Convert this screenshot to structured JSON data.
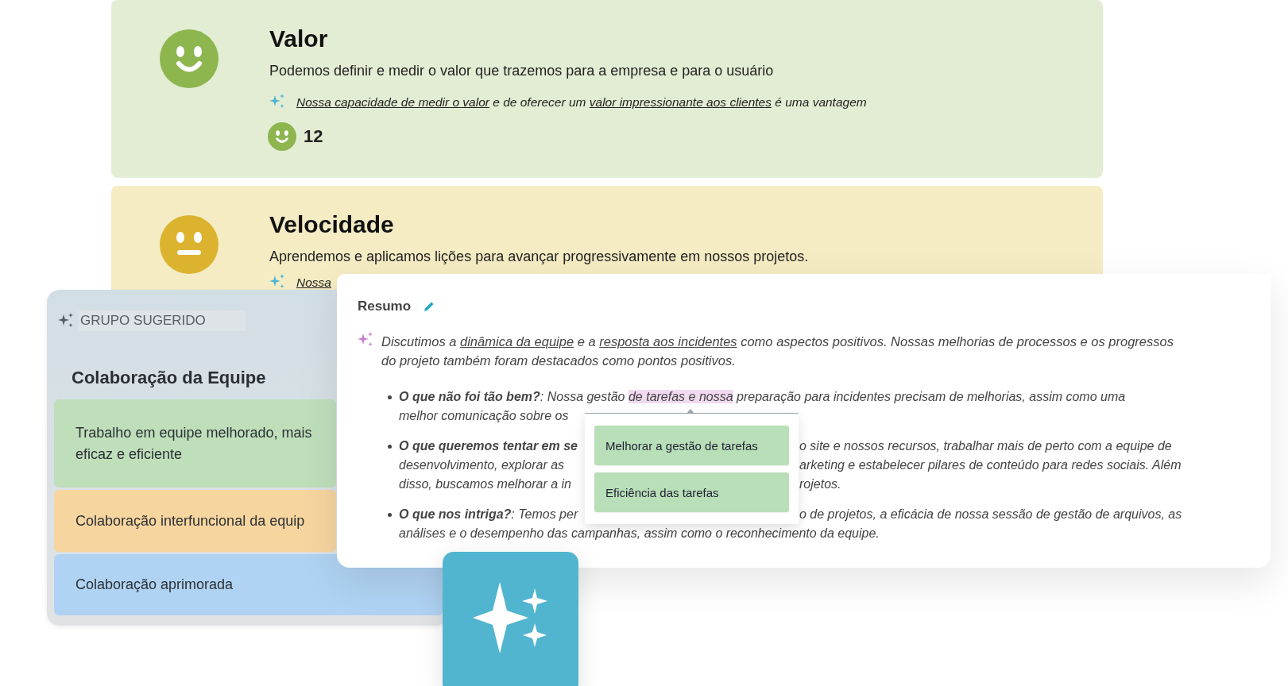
{
  "cards": [
    {
      "title": "Valor",
      "kind": "happy",
      "color": "#e3edd3",
      "description": "Podemos definir e medir o valor que trazemos para a empresa e para o usuário",
      "insight": [
        {
          "text": "Nossa capacidade de medir o valor",
          "link": true
        },
        {
          "text": " e de oferecer um ",
          "link": false
        },
        {
          "text": "valor impressionante aos clientes",
          "link": true
        },
        {
          "text": " é uma vantagem",
          "link": false
        }
      ],
      "count": "12"
    },
    {
      "title": "Velocidade",
      "kind": "neutral",
      "color": "#f5ecc4",
      "description": "Aprendemos e aplicamos lições para avançar progressivamente em nossos projetos.",
      "insight": [
        {
          "text": "Nossa",
          "link": true
        }
      ]
    }
  ],
  "suggested_group": {
    "label": "GRUPO SUGERIDO",
    "title": "Colaboração da Equipe",
    "items": [
      {
        "text": "Trabalho em equipe melhorado, mais eficaz e eficiente",
        "color": "#bfdfbb"
      },
      {
        "text": "Colaboração interfuncional da equip",
        "color": "#f6d59f"
      },
      {
        "text": "Colaboração aprimorada",
        "color": "#b0d3f3"
      }
    ]
  },
  "summary": {
    "title": "Resumo",
    "intro": [
      {
        "text": "Discutimos a ",
        "link": false
      },
      {
        "text": "dinâmica da equipe",
        "link": true
      },
      {
        "text": " e a ",
        "link": false
      },
      {
        "text": "resposta aos incidentes",
        "link": true
      },
      {
        "text": " como aspectos positivos. Nossas melhorias de processos e os progressos do projeto também foram destacados como pontos positivos.",
        "link": false
      }
    ],
    "bullets": [
      {
        "lines": [
          {
            "parts": [
              {
                "text": "**O que não foi tão bem?**: Nossa gestão ",
                "highlighted": false
              },
              {
                "text": "de tarefas e nossa",
                "highlighted": true
              },
              {
                "text": " preparação para incidentes precisam de melhorias, assim como uma",
                "highlighted": false
              }
            ]
          },
          {
            "parts": [
              {
                "text": "melhor comunicação sobre os",
                "highlighted": false
              }
            ]
          }
        ]
      },
      {
        "lines": [
          {
            "parts": [
              {
                "text": "**O que queremos tentar em se**",
                "highlighted": false
              }
            ],
            "right": "o site e nossos recursos, trabalhar mais de perto com a equipe de"
          },
          {
            "parts": [
              {
                "text": "desenvolvimento, explorar as",
                "highlighted": false
              }
            ],
            "right": "arketing e estabelecer pilares de conteúdo para redes sociais. Além"
          },
          {
            "parts": [
              {
                "text": "disso, buscamos melhorar a in",
                "highlighted": false
              }
            ],
            "right": "rojetos."
          }
        ]
      },
      {
        "lines": [
          {
            "parts": [
              {
                "text": "**O que nos intriga?**: Temos per",
                "highlighted": false
              }
            ],
            "right": "o de projetos, a eficácia de nossa sessão de gestão de arquivos, as"
          },
          {
            "parts": [
              {
                "text": "análises e o desempenho das campanhas, assim como o reconhecimento da equipe.",
                "highlighted": false
              }
            ]
          }
        ]
      }
    ],
    "suggestions": [
      "Melhorar a gestão de tarefas",
      "Eficiência das tarefas"
    ]
  }
}
